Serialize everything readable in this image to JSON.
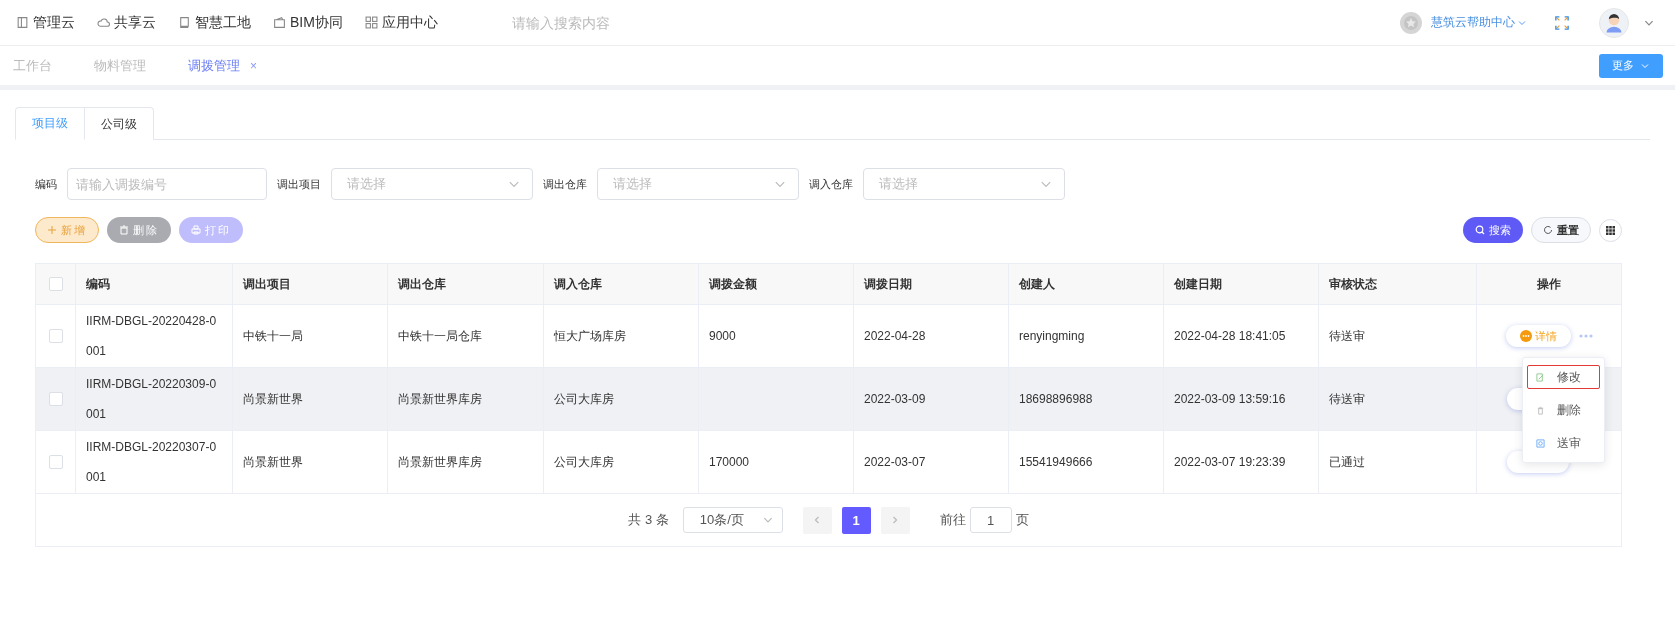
{
  "top_nav": {
    "items": [
      {
        "label": "管理云",
        "kind": "doc"
      },
      {
        "label": "共享云",
        "kind": "cloud"
      },
      {
        "label": "智慧工地",
        "kind": "book"
      },
      {
        "label": "BIM协同",
        "kind": "wallet"
      },
      {
        "label": "应用中心",
        "kind": "grid"
      }
    ],
    "search": {
      "placeholder": "请输入搜索内容"
    },
    "help": {
      "label": "慧筑云帮助中心"
    }
  },
  "page_tabs": [
    {
      "label": "工作台",
      "selected": false,
      "closable": false
    },
    {
      "label": "物料管理",
      "selected": false,
      "closable": false
    },
    {
      "label": "调拨管理",
      "selected": true,
      "closable": true
    }
  ],
  "close_glyph": "×",
  "more_button": {
    "label": "更多"
  },
  "level_tabs": [
    {
      "label": "项目级",
      "selected": true
    },
    {
      "label": "公司级",
      "selected": false
    }
  ],
  "filters": [
    {
      "label": "编码",
      "kind": "input",
      "placeholder": "请输入调拨编号"
    },
    {
      "label": "调出项目",
      "kind": "select",
      "placeholder": "请选择"
    },
    {
      "label": "调出仓库",
      "kind": "select",
      "placeholder": "请选择"
    },
    {
      "label": "调入仓库",
      "kind": "select",
      "placeholder": "请选择"
    }
  ],
  "toolbar": {
    "actions": [
      {
        "label": "新增",
        "kind": "add"
      },
      {
        "label": "删除",
        "kind": "delete"
      },
      {
        "label": "打印",
        "kind": "print"
      }
    ],
    "search": {
      "label": "搜索"
    },
    "reset": {
      "label": "重置"
    }
  },
  "table": {
    "all_checked": false,
    "columns": [
      "编码",
      "调出项目",
      "调出仓库",
      "调入仓库",
      "调拨金额",
      "调拨日期",
      "创建人",
      "创建日期",
      "审核状态",
      "操作"
    ],
    "rows": [
      {
        "checked": false,
        "highlighted": false,
        "cells": [
          "IIRM-DBGL-20220428-0001",
          "中铁十一局",
          "中铁十一局仓库",
          "恒大广场库房",
          "9000",
          "2022-04-28",
          "renyingming",
          "2022-04-28 18:41:05",
          "待送审"
        ],
        "action_label": "详情"
      },
      {
        "checked": false,
        "highlighted": true,
        "cells": [
          "IIRM-DBGL-20220309-0001",
          "尚景新世界",
          "尚景新世界库房",
          "公司大库房",
          null,
          "2022-03-09",
          "18698896988",
          "2022-03-09 13:59:16",
          "待送审"
        ]
      },
      {
        "checked": false,
        "highlighted": false,
        "cells": [
          "IIRM-DBGL-20220307-0001",
          "尚景新世界",
          "尚景新世界库房",
          "公司大库房",
          "170000",
          "2022-03-07",
          "15541949666",
          "2022-03-07 19:23:39",
          "已通过"
        ]
      }
    ]
  },
  "action_menu": {
    "items": [
      {
        "label": "修改",
        "kind": "edit",
        "focused": true
      },
      {
        "label": "删除",
        "kind": "delete",
        "focused": false
      },
      {
        "label": "送审",
        "kind": "submit",
        "focused": false
      }
    ]
  },
  "pagination": {
    "total": "共 3 条",
    "page_size": "10条/页",
    "pages": [
      {
        "label": "1",
        "selected": true
      }
    ],
    "goto_label": "前往",
    "goto_value": "1",
    "goto_suffix": "页"
  }
}
